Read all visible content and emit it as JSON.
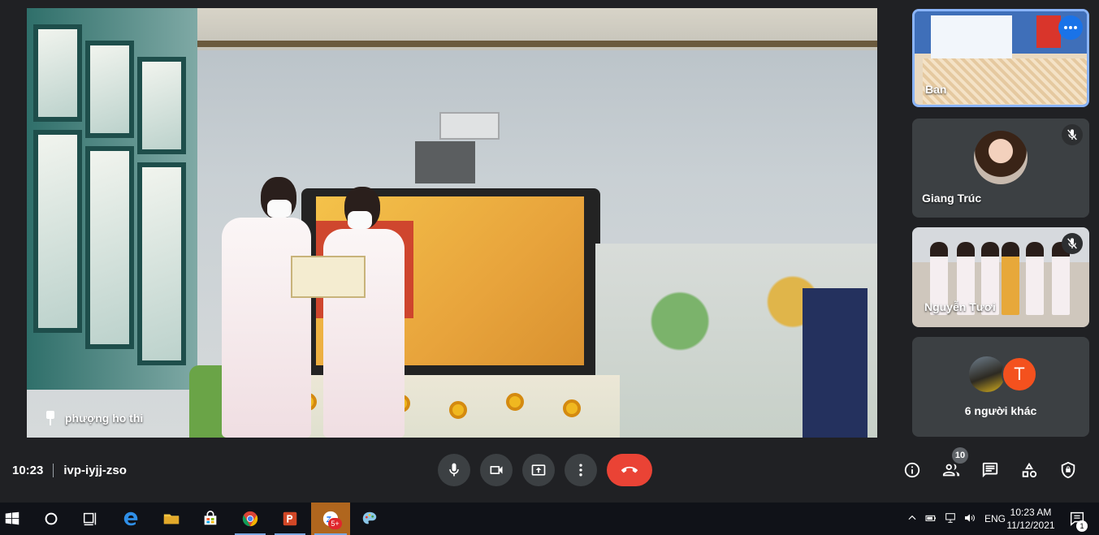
{
  "main_video": {
    "participant_name": "phượng ho thi",
    "pinned": true,
    "muted": true
  },
  "tiles": [
    {
      "name": "Ban",
      "muted": false,
      "active": true
    },
    {
      "name": "Giang Trúc",
      "muted": true
    },
    {
      "name": "Nguyễn Tươi",
      "muted": true
    },
    {
      "name": "6 người khác",
      "avatar_letter": "T"
    }
  ],
  "meeting_bar": {
    "time": "10:23",
    "meeting_code": "ivp-iyjj-zso",
    "participants_count": "10"
  },
  "taskbar": {
    "apps": [
      "start-icon",
      "cortana-icon",
      "task-view-icon",
      "edge-icon",
      "file-explorer-icon",
      "store-icon",
      "chrome-icon",
      "powerpoint-icon",
      "zalo-icon",
      "paint-icon"
    ],
    "zalo_badge": "5+",
    "language": "ENG",
    "clock_time": "10:23 AM",
    "clock_date": "11/12/2021",
    "notifications_count": "1"
  },
  "colors": {
    "background": "#202124",
    "tile": "#3c4043",
    "end_call": "#ea4335",
    "active_border": "#8ab4f8",
    "avatar_t": "#f4511e"
  }
}
